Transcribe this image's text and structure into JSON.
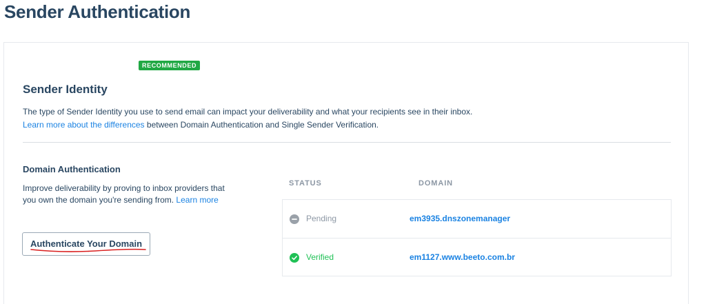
{
  "page": {
    "title": "Sender Authentication"
  },
  "identity": {
    "badge": "RECOMMENDED",
    "title": "Sender Identity",
    "description": "The type of Sender Identity you use to send email can impact your deliverability and what your recipients see in their inbox.",
    "learn_link": "Learn more about the differences",
    "learn_suffix": " between Domain Authentication and Single Sender Verification."
  },
  "domain_auth": {
    "title": "Domain Authentication",
    "description": "Improve deliverability by proving to inbox providers that you own the domain you're sending from. ",
    "learn_link": "Learn more",
    "button_label": "Authenticate Your Domain"
  },
  "table": {
    "headers": {
      "status": "STATUS",
      "domain": "DOMAIN"
    },
    "rows": [
      {
        "status": "Pending",
        "status_icon": "pending-icon",
        "status_color": "#9aa1a9",
        "text_color": "#8c97a4",
        "domain": "em3935.dnszonemanager"
      },
      {
        "status": "Verified",
        "status_icon": "check-circle-icon",
        "status_color": "#20c156",
        "text_color": "#20c156",
        "domain": "em1127.www.beeto.com.br"
      }
    ]
  },
  "colors": {
    "heading": "#294661",
    "link": "#1a82e2",
    "badge": "#20a844",
    "annotation": "#d91e1e"
  }
}
